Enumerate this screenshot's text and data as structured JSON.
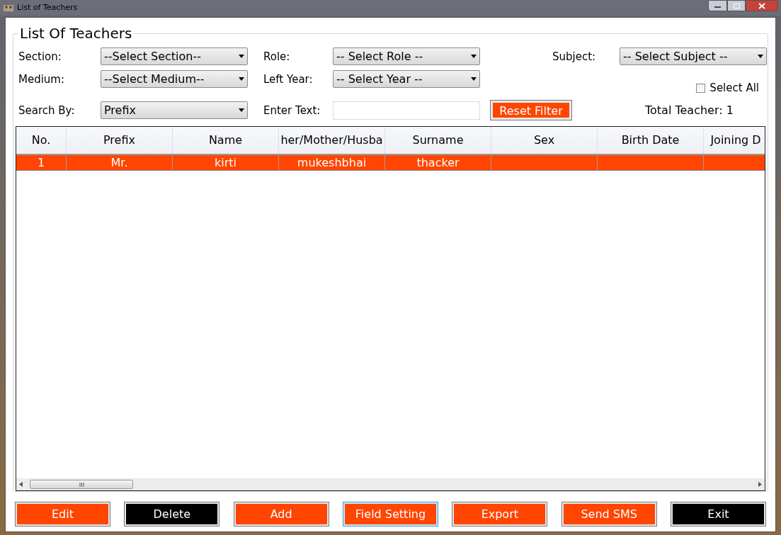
{
  "window": {
    "title": "List of Teachers"
  },
  "group_title": "List Of Teachers",
  "filters": {
    "section": {
      "label": "Section:",
      "value": "--Select Section--"
    },
    "role": {
      "label": "Role:",
      "value": "-- Select Role --"
    },
    "subject": {
      "label": "Subject:",
      "value": "-- Select Subject --"
    },
    "medium": {
      "label": "Medium:",
      "value": "--Select Medium--"
    },
    "left_year": {
      "label": "Left Year:",
      "value": "-- Select Year --"
    },
    "select_all": {
      "label": "Select All",
      "checked": false
    },
    "search_by": {
      "label": "Search By:",
      "value": "Prefix"
    },
    "enter_text": {
      "label": "Enter Text:"
    },
    "reset_button": "Reset Filter",
    "total": "Total Teacher: 1"
  },
  "table": {
    "columns": [
      "No.",
      "Prefix",
      "Name",
      "her/Mother/Husba",
      "Surname",
      "Sex",
      "Birth Date",
      "Joining D"
    ],
    "rows": [
      {
        "selected": true,
        "cells": [
          "1",
          "Mr.",
          "kirti",
          "mukeshbhai",
          "thacker",
          "",
          "",
          ""
        ]
      }
    ]
  },
  "buttons": [
    {
      "label": "Edit",
      "color": "#ff4500",
      "focused": false
    },
    {
      "label": "Delete",
      "color": "#000000",
      "focused": false
    },
    {
      "label": "Add",
      "color": "#ff4500",
      "focused": false
    },
    {
      "label": "Field Setting",
      "color": "#ff4500",
      "focused": true
    },
    {
      "label": "Export",
      "color": "#ff4500",
      "focused": false
    },
    {
      "label": "Send SMS",
      "color": "#ff4500",
      "focused": false
    },
    {
      "label": "Exit",
      "color": "#000000",
      "focused": false
    }
  ]
}
